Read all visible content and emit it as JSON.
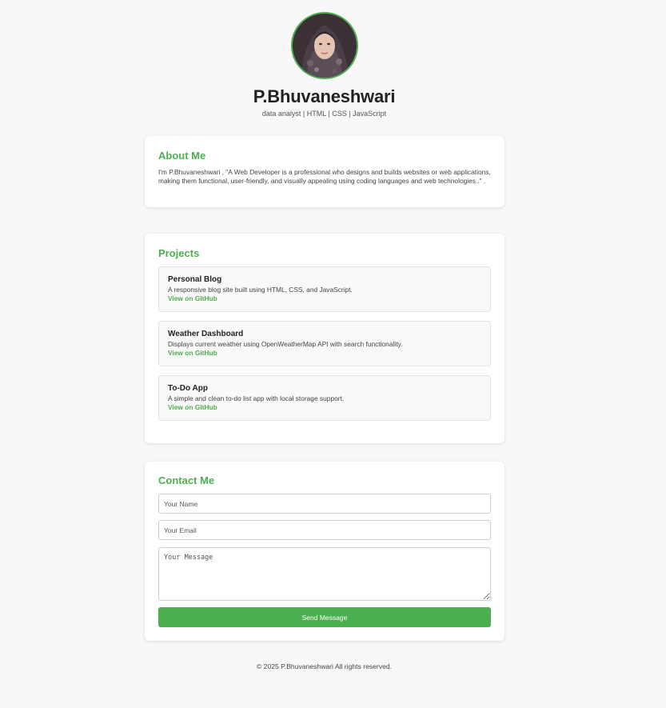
{
  "profile": {
    "name": "P.Bhuvaneshwari",
    "tagline": "data analyst | HTML | CSS | JavaScript",
    "accent_color": "#4caf50"
  },
  "about": {
    "heading": "About Me",
    "text": "I'm P.Bhuvaneshwari , \"A Web Developer is a professional who designs and builds websites or web applications, making them functional, user-friendly, and visually appealing using coding languages and web technologies..\" ."
  },
  "projects": {
    "heading": "Projects",
    "items": [
      {
        "title": "Personal Blog",
        "description": "A responsive blog site built using HTML, CSS, and JavaScript.",
        "link": "View on GitHub"
      },
      {
        "title": "Weather Dashboard",
        "description": "Displays current weather using OpenWeatherMap API with search functionality.",
        "link": "View on GitHub"
      },
      {
        "title": "To-Do App",
        "description": "A simple and clean to-do list app with local storage support.",
        "link": "View on GitHub"
      }
    ]
  },
  "contact": {
    "heading": "Contact Me",
    "name_placeholder": "Your Name",
    "email_placeholder": "Your Email",
    "message_placeholder": "Your Message",
    "send_label": "Send Message"
  },
  "footer": {
    "text": "© 2025 P.Bhuvaneshwari All rights reserved."
  }
}
